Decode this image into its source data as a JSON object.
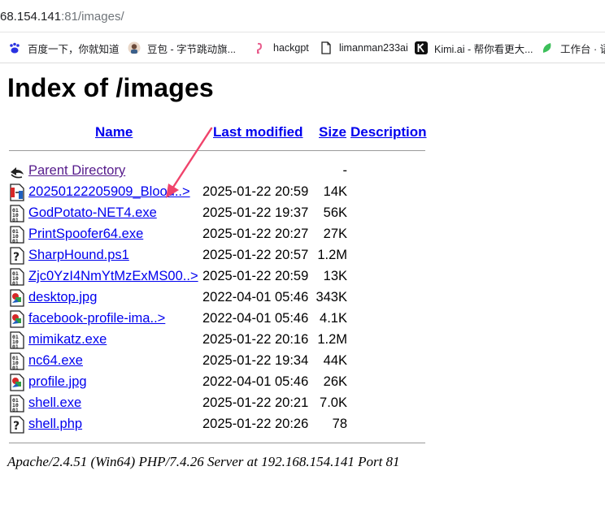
{
  "browser": {
    "url_host": "68.154.141",
    "url_path": ":81/images/",
    "bookmarks": [
      {
        "label": "百度一下，你就知道",
        "icon": "baidu-paw-icon"
      },
      {
        "label": "豆包 - 字节跳动旗...",
        "icon": "doubao-avatar-icon"
      },
      {
        "label": "hackgpt",
        "icon": "hackgpt-icon"
      },
      {
        "label": "limanman233ai",
        "icon": "document-icon"
      },
      {
        "label": "Kimi.ai - 帮你看更大...",
        "icon": "kimi-k-icon"
      },
      {
        "label": "工作台 · 语",
        "icon": "leaf-icon"
      }
    ]
  },
  "page": {
    "title": "Index of /images",
    "columns": {
      "name": "Name",
      "last_modified": "Last modified",
      "size": "Size",
      "description": "Description"
    },
    "parent": {
      "name": "Parent Directory",
      "size": "-"
    },
    "files": [
      {
        "name": "20250122205909_Blood..>",
        "date": "2025-01-22 20:59",
        "size": "14K",
        "icon": "compressed-file-icon"
      },
      {
        "name": "GodPotato-NET4.exe",
        "date": "2025-01-22 19:37",
        "size": "56K",
        "icon": "binary-file-icon"
      },
      {
        "name": "PrintSpoofer64.exe",
        "date": "2025-01-22 20:27",
        "size": "27K",
        "icon": "binary-file-icon"
      },
      {
        "name": "SharpHound.ps1",
        "date": "2025-01-22 20:57",
        "size": "1.2M",
        "icon": "unknown-file-icon"
      },
      {
        "name": "Zjc0YzI4NmYtMzExMS00..>",
        "date": "2025-01-22 20:59",
        "size": "13K",
        "icon": "binary-file-icon"
      },
      {
        "name": "desktop.jpg",
        "date": "2022-04-01 05:46",
        "size": "343K",
        "icon": "image-file-icon"
      },
      {
        "name": "facebook-profile-ima..>",
        "date": "2022-04-01 05:46",
        "size": "4.1K",
        "icon": "image-file-icon"
      },
      {
        "name": "mimikatz.exe",
        "date": "2025-01-22 20:16",
        "size": "1.2M",
        "icon": "binary-file-icon"
      },
      {
        "name": "nc64.exe",
        "date": "2025-01-22 19:34",
        "size": "44K",
        "icon": "binary-file-icon"
      },
      {
        "name": "profile.jpg",
        "date": "2022-04-01 05:46",
        "size": "26K",
        "icon": "image-file-icon"
      },
      {
        "name": "shell.exe",
        "date": "2025-01-22 20:21",
        "size": "7.0K",
        "icon": "binary-file-icon"
      },
      {
        "name": "shell.php",
        "date": "2025-01-22 20:26",
        "size": "78",
        "icon": "unknown-file-icon"
      }
    ],
    "footer": "Apache/2.4.51 (Win64) PHP/7.4.26 Server at 192.168.154.141 Port 81"
  },
  "colors": {
    "link": "#0000ee",
    "visited_link": "#551a8b",
    "annotation_arrow": "#f0436b"
  }
}
